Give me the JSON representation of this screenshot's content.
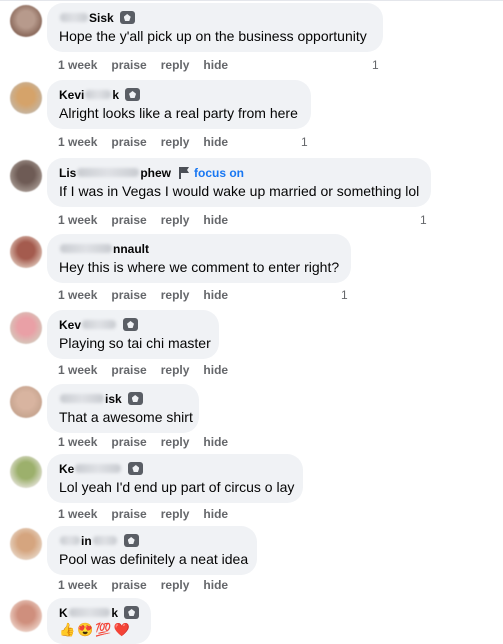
{
  "comments": [
    {
      "name_prefix": "",
      "name_visible": "Sisk",
      "name_suffix": "",
      "text": "Hope the y'all pick up on the business opportunity",
      "time": "1 week",
      "like": "praise",
      "reply": "reply",
      "hide": "hide",
      "reactions": "1",
      "avatar": [
        "#b79a8c",
        "#8b6a5c"
      ]
    },
    {
      "name_prefix": "Kevi",
      "name_visible": "",
      "name_suffix": "k",
      "text": "Alright looks like a real party from here",
      "time": "1 week",
      "like": "praise",
      "reply": "reply",
      "hide": "hide",
      "reactions": "1",
      "avatar": [
        "#d5a36a",
        "#c7b39b"
      ]
    },
    {
      "name_prefix": "Lis",
      "name_visible": "",
      "name_suffix": "phew",
      "follow": "focus on",
      "text": "If I was in Vegas I would wake up married or something lol",
      "time": "1 week",
      "like": "praise",
      "reply": "reply",
      "hide": "hide",
      "reactions": "1",
      "avatar": [
        "#6e5b55",
        "#9d8f88"
      ]
    },
    {
      "name_prefix": "",
      "name_visible": "",
      "name_suffix": "nnault",
      "text": "Hey this is where we comment to enter right?",
      "time": "1 week",
      "like": "praise",
      "reply": "reply",
      "hide": "hide",
      "reactions": "1",
      "avatar": [
        "#a45b4e",
        "#d3b0a3"
      ]
    },
    {
      "name_prefix": "Kev",
      "name_visible": "",
      "name_suffix": "",
      "text": "Playing so tai chi master",
      "time": "1 week",
      "like": "praise",
      "reply": "reply",
      "hide": "hide",
      "reactions": "",
      "avatar": [
        "#e9a0a6",
        "#d8c2b8"
      ]
    },
    {
      "name_prefix": "",
      "name_visible": "",
      "name_suffix": "isk",
      "text": "That a awesome shirt",
      "time": "1 week",
      "like": "praise",
      "reply": "reply",
      "hide": "hide",
      "reactions": "",
      "avatar": [
        "#d8b4a0",
        "#c7a590"
      ]
    },
    {
      "name_prefix": "Ke",
      "name_visible": "",
      "name_suffix": "",
      "text": "Lol yeah I'd end up part of circus o lay",
      "time": "1 week",
      "like": "praise",
      "reply": "reply",
      "hide": "hide",
      "reactions": "",
      "avatar": [
        "#9cb06c",
        "#d7d9c4"
      ]
    },
    {
      "name_prefix": "",
      "name_visible": "",
      "name_suffix": "in",
      "text": "Pool was definitely a neat idea",
      "time": "1 week",
      "like": "praise",
      "reply": "reply",
      "hide": "hide",
      "reactions": "",
      "avatar": [
        "#d5a57f",
        "#e4cdb9"
      ]
    },
    {
      "name_prefix": "K",
      "name_visible": "",
      "name_suffix": "k",
      "text": "",
      "emojis": [
        "👍",
        "😍",
        "💯",
        "❤️"
      ],
      "time": "",
      "like": "",
      "reply": "",
      "hide": "",
      "reactions": "",
      "avatar": [
        "#cf8f7d",
        "#e8c7bb"
      ]
    }
  ],
  "colors": {
    "bubble": "#f0f2f5",
    "link": "#1877f2",
    "meta": "#65676b"
  }
}
